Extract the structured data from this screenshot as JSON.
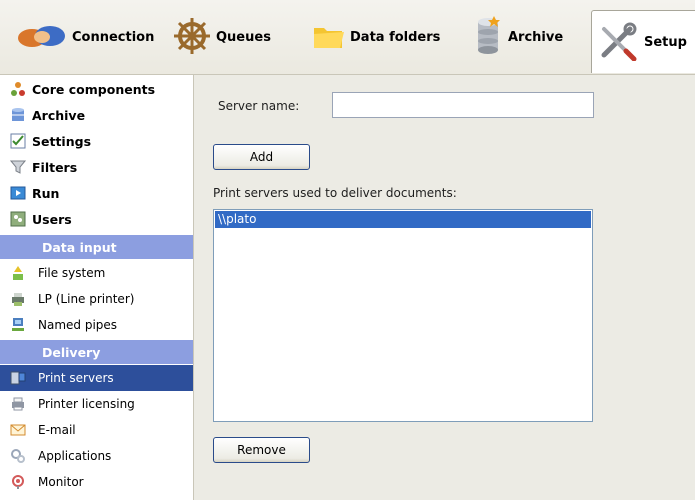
{
  "toolbar": {
    "items": [
      {
        "label": "Connection",
        "icon": "handshake-icon"
      },
      {
        "label": "Queues",
        "icon": "ship-wheel-icon"
      },
      {
        "label": "Data folders",
        "icon": "folder-icon"
      },
      {
        "label": "Archive",
        "icon": "database-icon"
      },
      {
        "label": "Setup",
        "icon": "tools-icon",
        "selected": true
      }
    ]
  },
  "sidebar": {
    "items": [
      {
        "label": "Core components",
        "icon": "components-icon"
      },
      {
        "label": "Archive",
        "icon": "database-icon"
      },
      {
        "label": "Settings",
        "icon": "checklist-icon"
      },
      {
        "label": "Filters",
        "icon": "funnel-icon"
      },
      {
        "label": "Run",
        "icon": "run-icon"
      },
      {
        "label": "Users",
        "icon": "users-icon"
      }
    ],
    "data_input": {
      "header": "Data input",
      "items": [
        {
          "label": "File system",
          "icon": "file-system-icon"
        },
        {
          "label": "LP (Line printer)",
          "icon": "line-printer-icon"
        },
        {
          "label": "Named pipes",
          "icon": "network-icon"
        }
      ]
    },
    "delivery": {
      "header": "Delivery",
      "items": [
        {
          "label": "Print servers",
          "icon": "print-server-icon",
          "active": true
        },
        {
          "label": "Printer licensing",
          "icon": "printer-icon"
        },
        {
          "label": "E-mail",
          "icon": "envelope-icon"
        },
        {
          "label": "Applications",
          "icon": "gears-icon"
        },
        {
          "label": "Monitor",
          "icon": "monitor-icon"
        }
      ]
    }
  },
  "main": {
    "server_name_label": "Server name:",
    "server_name_value": "",
    "add_button": "Add",
    "list_label": "Print servers used to deliver documents:",
    "list_items": [
      "\\\\plato"
    ],
    "remove_button": "Remove"
  },
  "colors": {
    "section_header": "#8c9ee0",
    "selected_row": "#2d4f9b",
    "list_selection": "#316ac5",
    "panel_background": "#ecebe4"
  }
}
